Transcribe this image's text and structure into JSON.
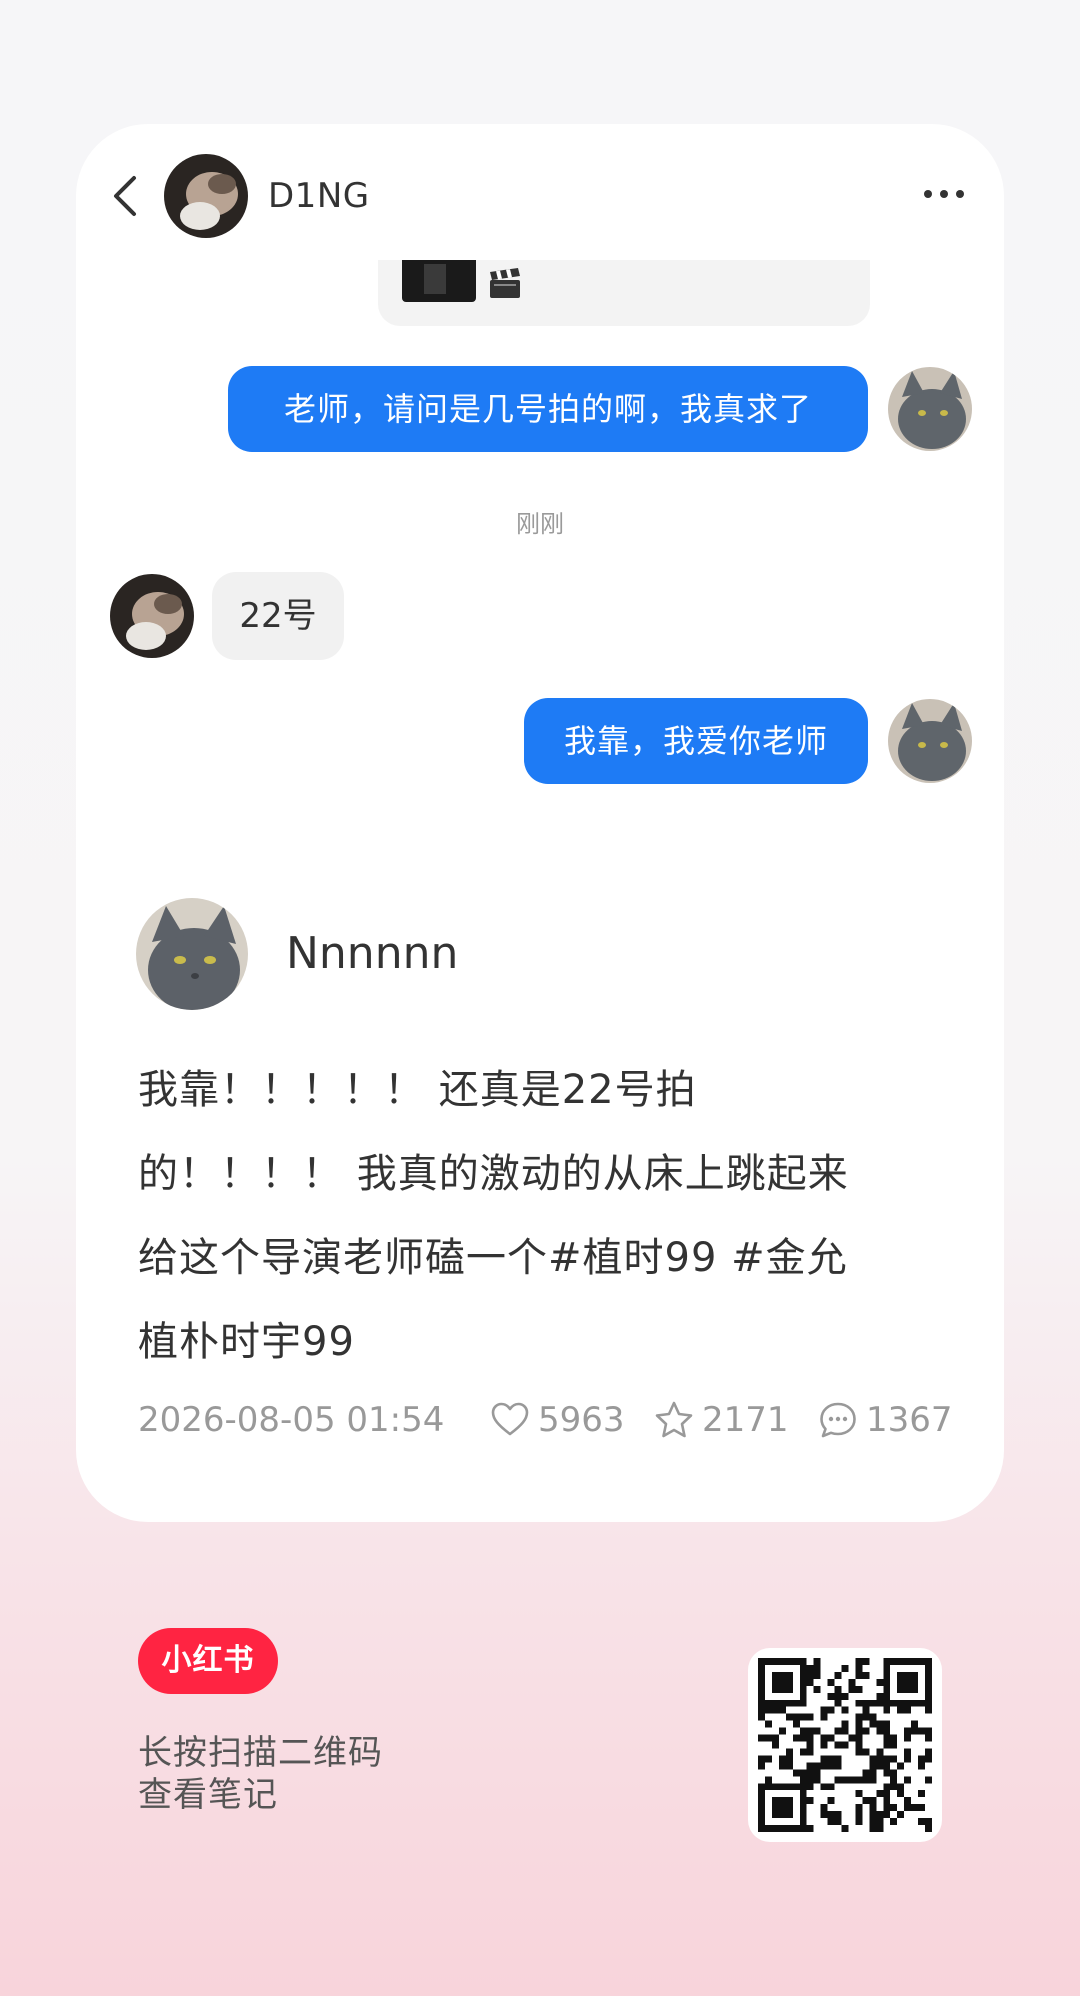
{
  "chat": {
    "contact_name": "D1NG",
    "messages": [
      {
        "side": "right",
        "text": "老师，请问是几号拍的啊，我真求了"
      },
      {
        "side": "left",
        "text": "22号"
      },
      {
        "side": "right",
        "text": "我靠，我爱你老师"
      }
    ],
    "time_separator": "刚刚",
    "preview_icon": "clapper-board-icon"
  },
  "note": {
    "author": "Nnnnnn",
    "text_lines": [
      "我靠！！！！！ 还真是22号拍",
      "的！！！！ 我真的激动的从床上跳起来",
      "给这个导演老师磕一个#植时99 #金允",
      "植朴时宇99"
    ],
    "date": "2026-08-05 01:54",
    "likes": "5963",
    "favorites": "2171",
    "comments": "1367"
  },
  "footer": {
    "brand": "小红书",
    "hint_line1": "长按扫描二维码",
    "hint_line2": "查看笔记"
  },
  "colors": {
    "bubble_blue": "#1e7bf5",
    "brand_red": "#ff2442"
  }
}
